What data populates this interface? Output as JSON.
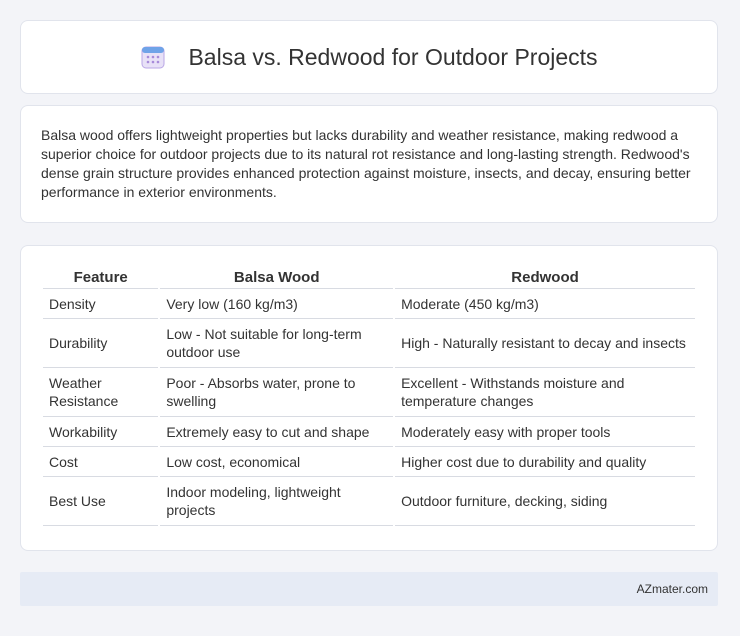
{
  "header": {
    "title": "Balsa vs. Redwood for Outdoor Projects",
    "icon": "calendar-icon"
  },
  "summary": {
    "text": "Balsa wood offers lightweight properties but lacks durability and weather resistance, making redwood a superior choice for outdoor projects due to its natural rot resistance and long-lasting strength. Redwood's dense grain structure provides enhanced protection against moisture, insects, and decay, ensuring better performance in exterior environments."
  },
  "table": {
    "headers": [
      "Feature",
      "Balsa Wood",
      "Redwood"
    ],
    "rows": [
      {
        "feature": "Density",
        "balsa": "Very low (160 kg/m3)",
        "redwood": "Moderate (450 kg/m3)"
      },
      {
        "feature": "Durability",
        "balsa": "Low - Not suitable for long-term outdoor use",
        "redwood": "High - Naturally resistant to decay and insects"
      },
      {
        "feature": "Weather Resistance",
        "balsa": "Poor - Absorbs water, prone to swelling",
        "redwood": "Excellent - Withstands moisture and temperature changes"
      },
      {
        "feature": "Workability",
        "balsa": "Extremely easy to cut and shape",
        "redwood": "Moderately easy with proper tools"
      },
      {
        "feature": "Cost",
        "balsa": "Low cost, economical",
        "redwood": "Higher cost due to durability and quality"
      },
      {
        "feature": "Best Use",
        "balsa": "Indoor modeling, lightweight projects",
        "redwood": "Outdoor furniture, decking, siding"
      }
    ]
  },
  "footer": {
    "text": "AZmater.com"
  },
  "colors": {
    "background": "#f3f4f8",
    "card": "#ffffff",
    "footer": "#e6ebf5",
    "icon_accent": "#a78bda"
  }
}
